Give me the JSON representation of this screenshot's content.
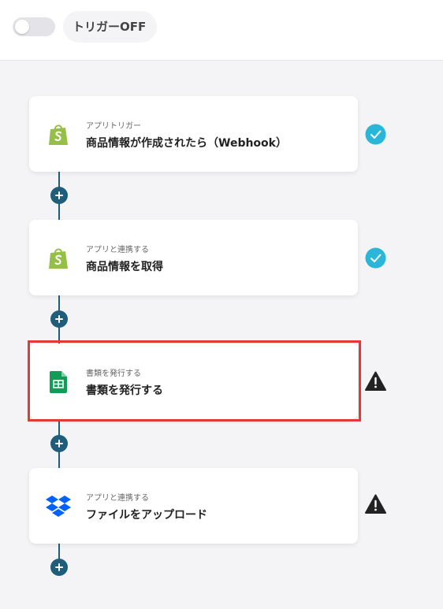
{
  "topbar": {
    "trigger_label": "トリガーOFF",
    "toggle_state": "off"
  },
  "steps": [
    {
      "subtitle": "アプリトリガー",
      "title": "商品情報が作成されたら（Webhook）",
      "app_icon": "shopify-icon",
      "status": "completed"
    },
    {
      "subtitle": "アプリと連携する",
      "title": "商品情報を取得",
      "app_icon": "shopify-icon",
      "status": "completed"
    },
    {
      "subtitle": "書類を発行する",
      "title": "書類を発行する",
      "app_icon": "google-sheets-icon",
      "status": "warning"
    },
    {
      "subtitle": "アプリと連携する",
      "title": "ファイルをアップロード",
      "app_icon": "dropbox-icon",
      "status": "warning"
    }
  ],
  "colors": {
    "accent": "#1f5d7a",
    "check": "#29b6d8",
    "warning": "#222222",
    "highlight": "#e53935",
    "shopify": "#95bf47",
    "sheets": "#0f9d58",
    "dropbox": "#0061fe"
  }
}
